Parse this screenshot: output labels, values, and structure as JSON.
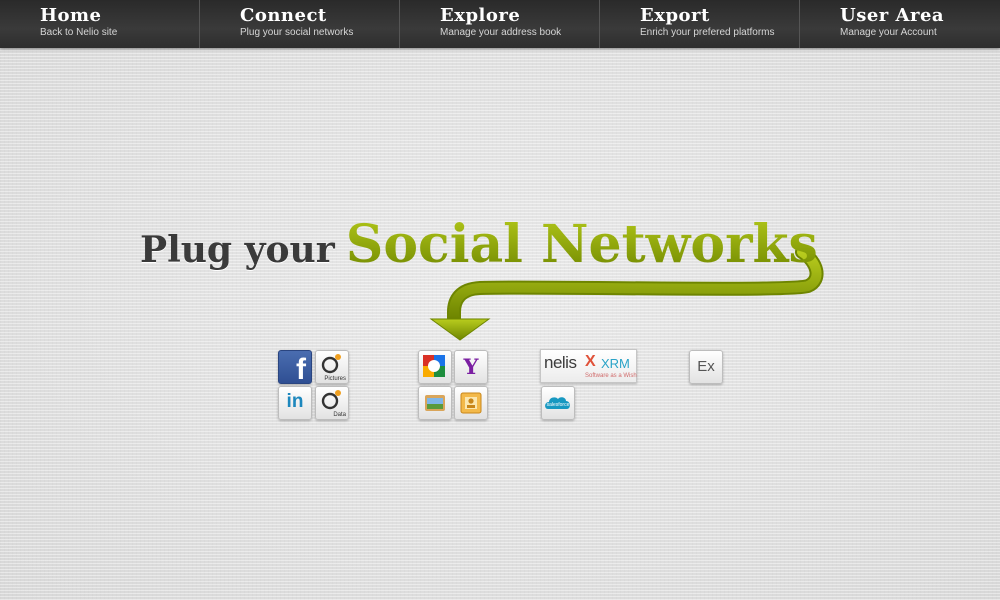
{
  "nav": {
    "items": [
      {
        "title": "Home",
        "subtitle": "Back to Nelio site"
      },
      {
        "title": "Connect",
        "subtitle": "Plug your social networks"
      },
      {
        "title": "Explore",
        "subtitle": "Manage your address book"
      },
      {
        "title": "Export",
        "subtitle": "Enrich your prefered platforms"
      },
      {
        "title": "User Area",
        "subtitle": "Manage your Account"
      }
    ]
  },
  "hero": {
    "lead": "Plug your",
    "accent": "Social Networks"
  },
  "services": {
    "facebook": {
      "glyph": "f"
    },
    "pictures": {
      "label": "Pictures"
    },
    "linkedin": {
      "glyph": "in"
    },
    "data": {
      "label": "Data"
    },
    "yahoo": {
      "glyph": "Y"
    },
    "nelis": {
      "word": "nelis",
      "x": "X",
      "xrm": "XRM",
      "tagline": "Software as a Wish"
    },
    "salesforce": {
      "label": "salesforce"
    },
    "exchange": {
      "glyph": "Ex"
    }
  },
  "colors": {
    "nav_bg": "#333333",
    "accent_green": "#8aa300",
    "facebook_blue": "#3b5998",
    "linkedin_blue": "#1d87bd",
    "yahoo_purple": "#7b1fa2",
    "salesforce_blue": "#1798c1"
  },
  "icons": {
    "facebook": "facebook-icon",
    "pictures": "pictures-icon",
    "linkedin": "linkedin-icon",
    "data": "data-icon",
    "google": "google-icon",
    "yahoo": "yahoo-icon",
    "windows_live": "windows-live-icon",
    "outlook_contacts": "outlook-contacts-icon",
    "nelis": "nelis-xrm-icon",
    "salesforce": "salesforce-icon",
    "exchange": "exchange-icon"
  }
}
